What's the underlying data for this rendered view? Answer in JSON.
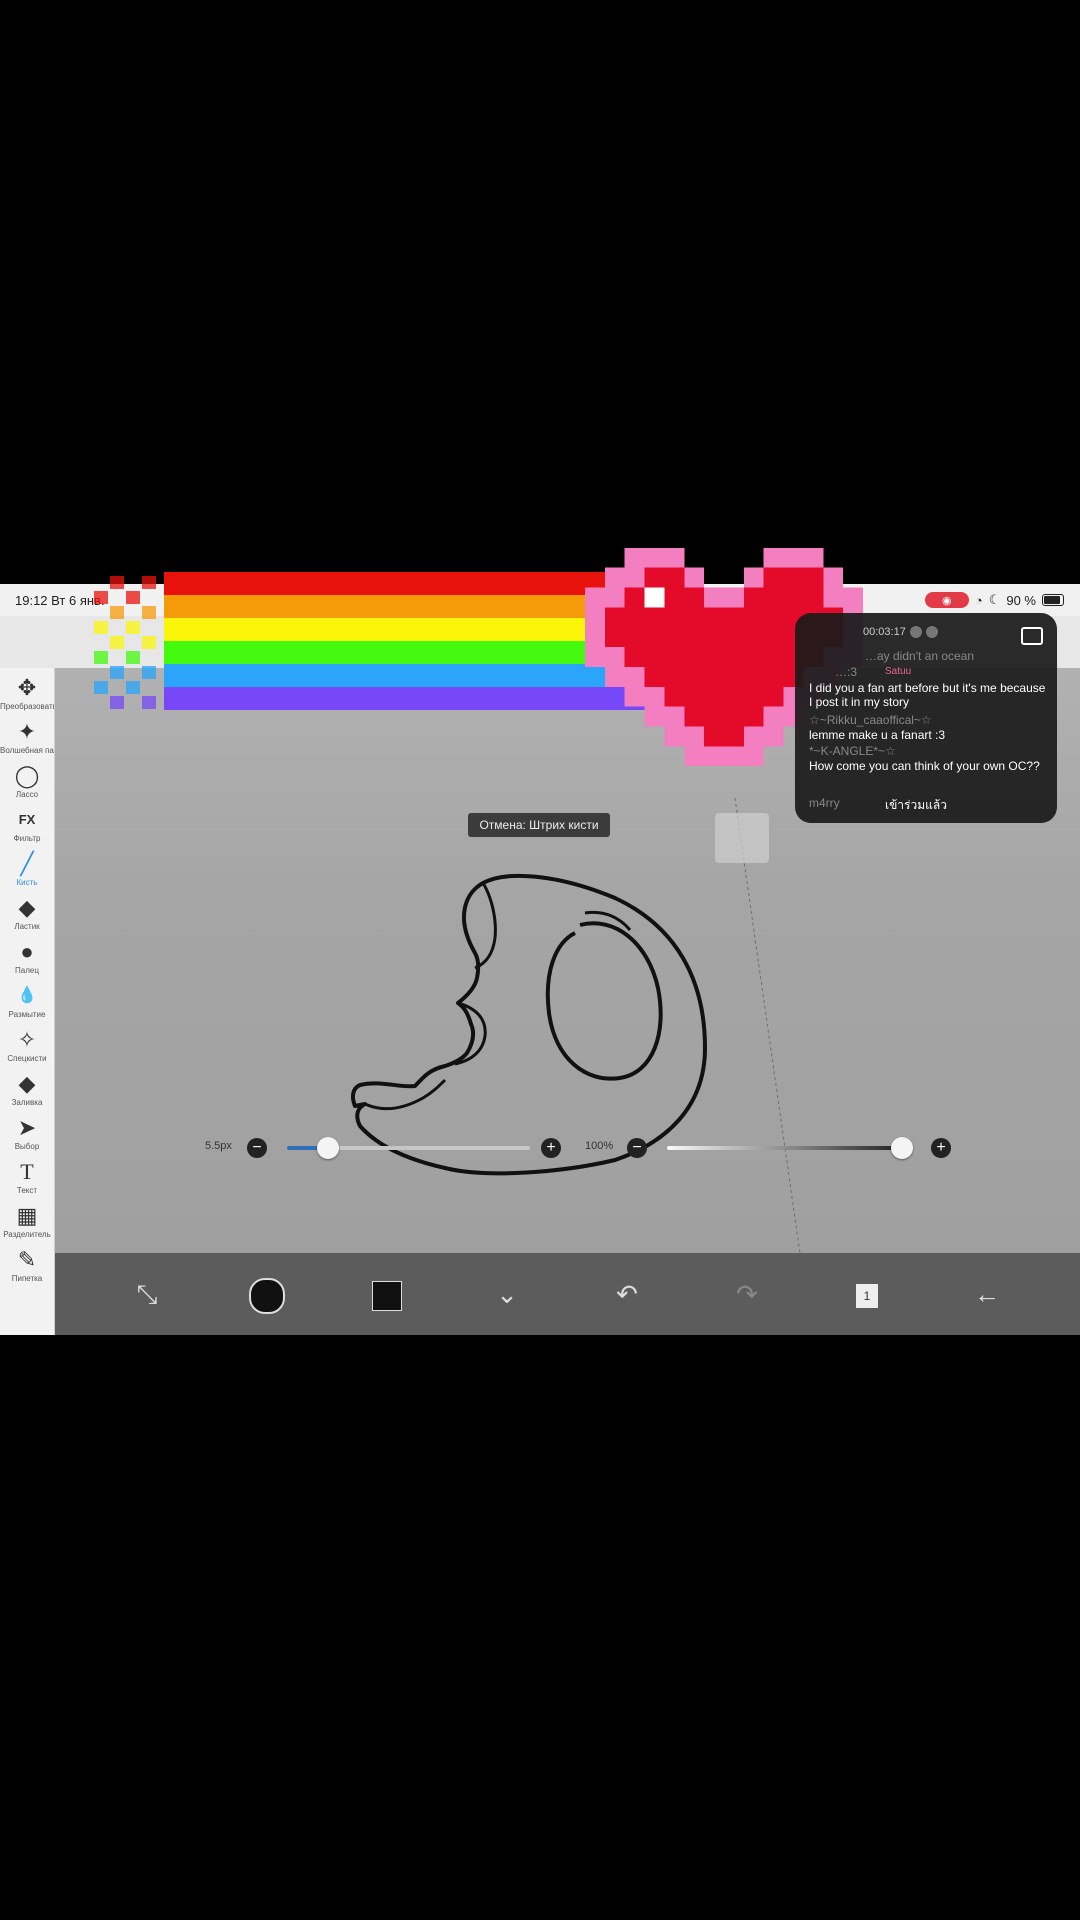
{
  "statusbar": {
    "time": "19:12",
    "date": "Вт 6 янв.",
    "battery": "90 %"
  },
  "toolbar": {
    "tools": [
      {
        "icon": "move-icon",
        "glyph": "✥",
        "label": "Преобразовать"
      },
      {
        "icon": "magic-wand-icon",
        "glyph": "✦",
        "label": "Волшебная палочка"
      },
      {
        "icon": "lasso-icon",
        "glyph": "◯",
        "label": "Лассо"
      },
      {
        "icon": "fx-icon",
        "glyph": "FX",
        "label": "Фильтр"
      },
      {
        "icon": "brush-icon",
        "glyph": "╱",
        "label": "Кисть"
      },
      {
        "icon": "eraser-icon",
        "glyph": "◆",
        "label": "Ластик"
      },
      {
        "icon": "smudge-icon",
        "glyph": "●",
        "label": "Палец"
      },
      {
        "icon": "blur-icon",
        "glyph": "💧",
        "label": "Размытие"
      },
      {
        "icon": "special-icon",
        "glyph": "✧",
        "label": "Спецкисти"
      },
      {
        "icon": "fill-icon",
        "glyph": "◆",
        "label": "Заливка"
      },
      {
        "icon": "select-icon",
        "glyph": "➤",
        "label": "Выбор"
      },
      {
        "icon": "text-icon",
        "glyph": "T",
        "label": "Текст"
      },
      {
        "icon": "divider-icon",
        "glyph": "▦",
        "label": "Разделитель"
      },
      {
        "icon": "eyedropper-icon",
        "glyph": "✎",
        "label": "Пипетка"
      }
    ]
  },
  "canvas": {
    "tooltip": "Отмена: Штрих кисти"
  },
  "sliders": {
    "size_label": "5.5px",
    "size_level": 0.17,
    "opacity_label": "100%",
    "opacity_level": 1.0
  },
  "bottombar": {
    "icons": [
      "transform-icon",
      "brush-color-icon",
      "color-swatch-icon",
      "down-icon",
      "undo-icon",
      "redo-icon",
      "layers-icon",
      "back-icon"
    ],
    "layer_count": "1"
  },
  "chat": {
    "timer": "00:03:17",
    "messages": [
      {
        "user": "…ay didn't an ocean",
        "text": ""
      },
      {
        "user": "…:3",
        "badge": "Satuu",
        "text": "I did you a fan art before but it's me because I post it in my story"
      },
      {
        "user": "☆~Rikku_caaoffical~☆",
        "text": "lemme make u a fanart :3"
      },
      {
        "user": "*~K-ANGLE*~☆",
        "text": "How come you can think of your own OC??"
      },
      {
        "user": "m4rry",
        "text": "เข้าร่วมแล้ว"
      }
    ]
  },
  "colors": {
    "accent": "#2f8ee5",
    "rec": "#e23a46",
    "rainbow": [
      "#e8120c",
      "#f59b0a",
      "#fbf609",
      "#44fa0e",
      "#2aa5fb",
      "#7648f8"
    ],
    "heart_fill": "#e30a2a",
    "heart_outline": "#f37fc0"
  }
}
